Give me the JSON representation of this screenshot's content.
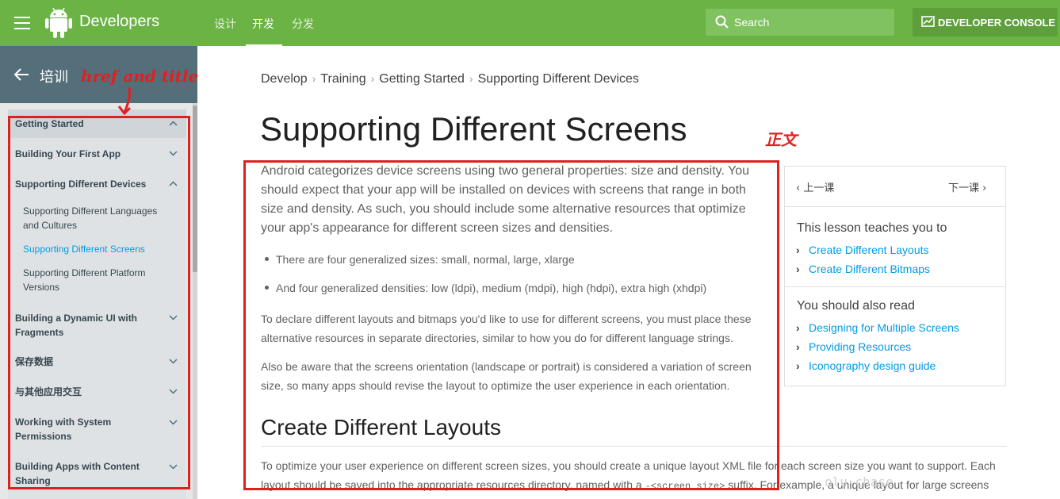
{
  "header": {
    "brand": "Developers",
    "tabs": [
      "设计",
      "开发",
      "分发"
    ],
    "active_tab": "开发",
    "search_placeholder": "Search",
    "console_label": "DEVELOPER CONSOLE",
    "brand_color": "#6ab344"
  },
  "sidebar": {
    "title": "培训",
    "items": [
      {
        "label": "Getting Started",
        "chevron": "up"
      },
      {
        "label": "Building Your First App",
        "chevron": "down"
      },
      {
        "label": "Supporting Different Devices",
        "chevron": "up"
      },
      {
        "label": "Supporting Different Languages and Cultures"
      },
      {
        "label": "Supporting Different Screens",
        "active": true
      },
      {
        "label": "Supporting Different Platform Versions"
      },
      {
        "label": "Building a Dynamic UI with Fragments",
        "chevron": "down"
      },
      {
        "label": "保存数据",
        "chevron": "down"
      },
      {
        "label": "与其他应用交互",
        "chevron": "down"
      },
      {
        "label": "Working with System Permissions",
        "chevron": "down"
      },
      {
        "label": "Building Apps with Content Sharing",
        "chevron": "down"
      }
    ]
  },
  "breadcrumb": [
    "Develop",
    "Training",
    "Getting Started",
    "Supporting Different Devices"
  ],
  "main": {
    "title": "Supporting Different Screens",
    "intro": "Android categorizes device screens using two general properties: size and density. You should expect that your app will be installed on devices with screens that range in both size and density. As such, you should include some alternative resources that optimize your app's appearance for different screen sizes and densities.",
    "bullets": [
      "There are four generalized sizes: small, normal, large, xlarge",
      "And four generalized densities: low (ldpi), medium (mdpi), high (hdpi), extra high (xhdpi)"
    ],
    "para2": "To declare different layouts and bitmaps you'd like to use for different screens, you must place these alternative resources in separate directories, similar to how you do for different language strings.",
    "para3": "Also be aware that the screens orientation (landscape or portrait) is considered a variation of screen size, so many apps should revise the layout to optimize the user experience in each orientation.",
    "section_title": "Create Different Layouts",
    "para4_line1": "To optimize your user experience on different screen sizes, you should create a unique layout XML file for each screen size you want to support. Each",
    "para4_line2a": "layout should be saved into the appropriate resources directory, named with a ",
    "para4_code": "-<screen_size>",
    "para4_line2b": " suffix. For example, a unique layout for large screens"
  },
  "lesson_panel": {
    "prev": "上一课",
    "next": "下一课",
    "teaches_heading": "This lesson teaches you to",
    "teaches_links": [
      "Create Different Layouts",
      "Create Different Bitmaps"
    ],
    "read_heading": "You should also read",
    "read_links": [
      "Designing for Multiple Screens",
      "Providing Resources",
      "Iconography design guide"
    ]
  },
  "annotations": {
    "sidebar_note": "href and title",
    "content_note": "正文",
    "color": "#e02020"
  },
  "watermark": "olu_chase"
}
